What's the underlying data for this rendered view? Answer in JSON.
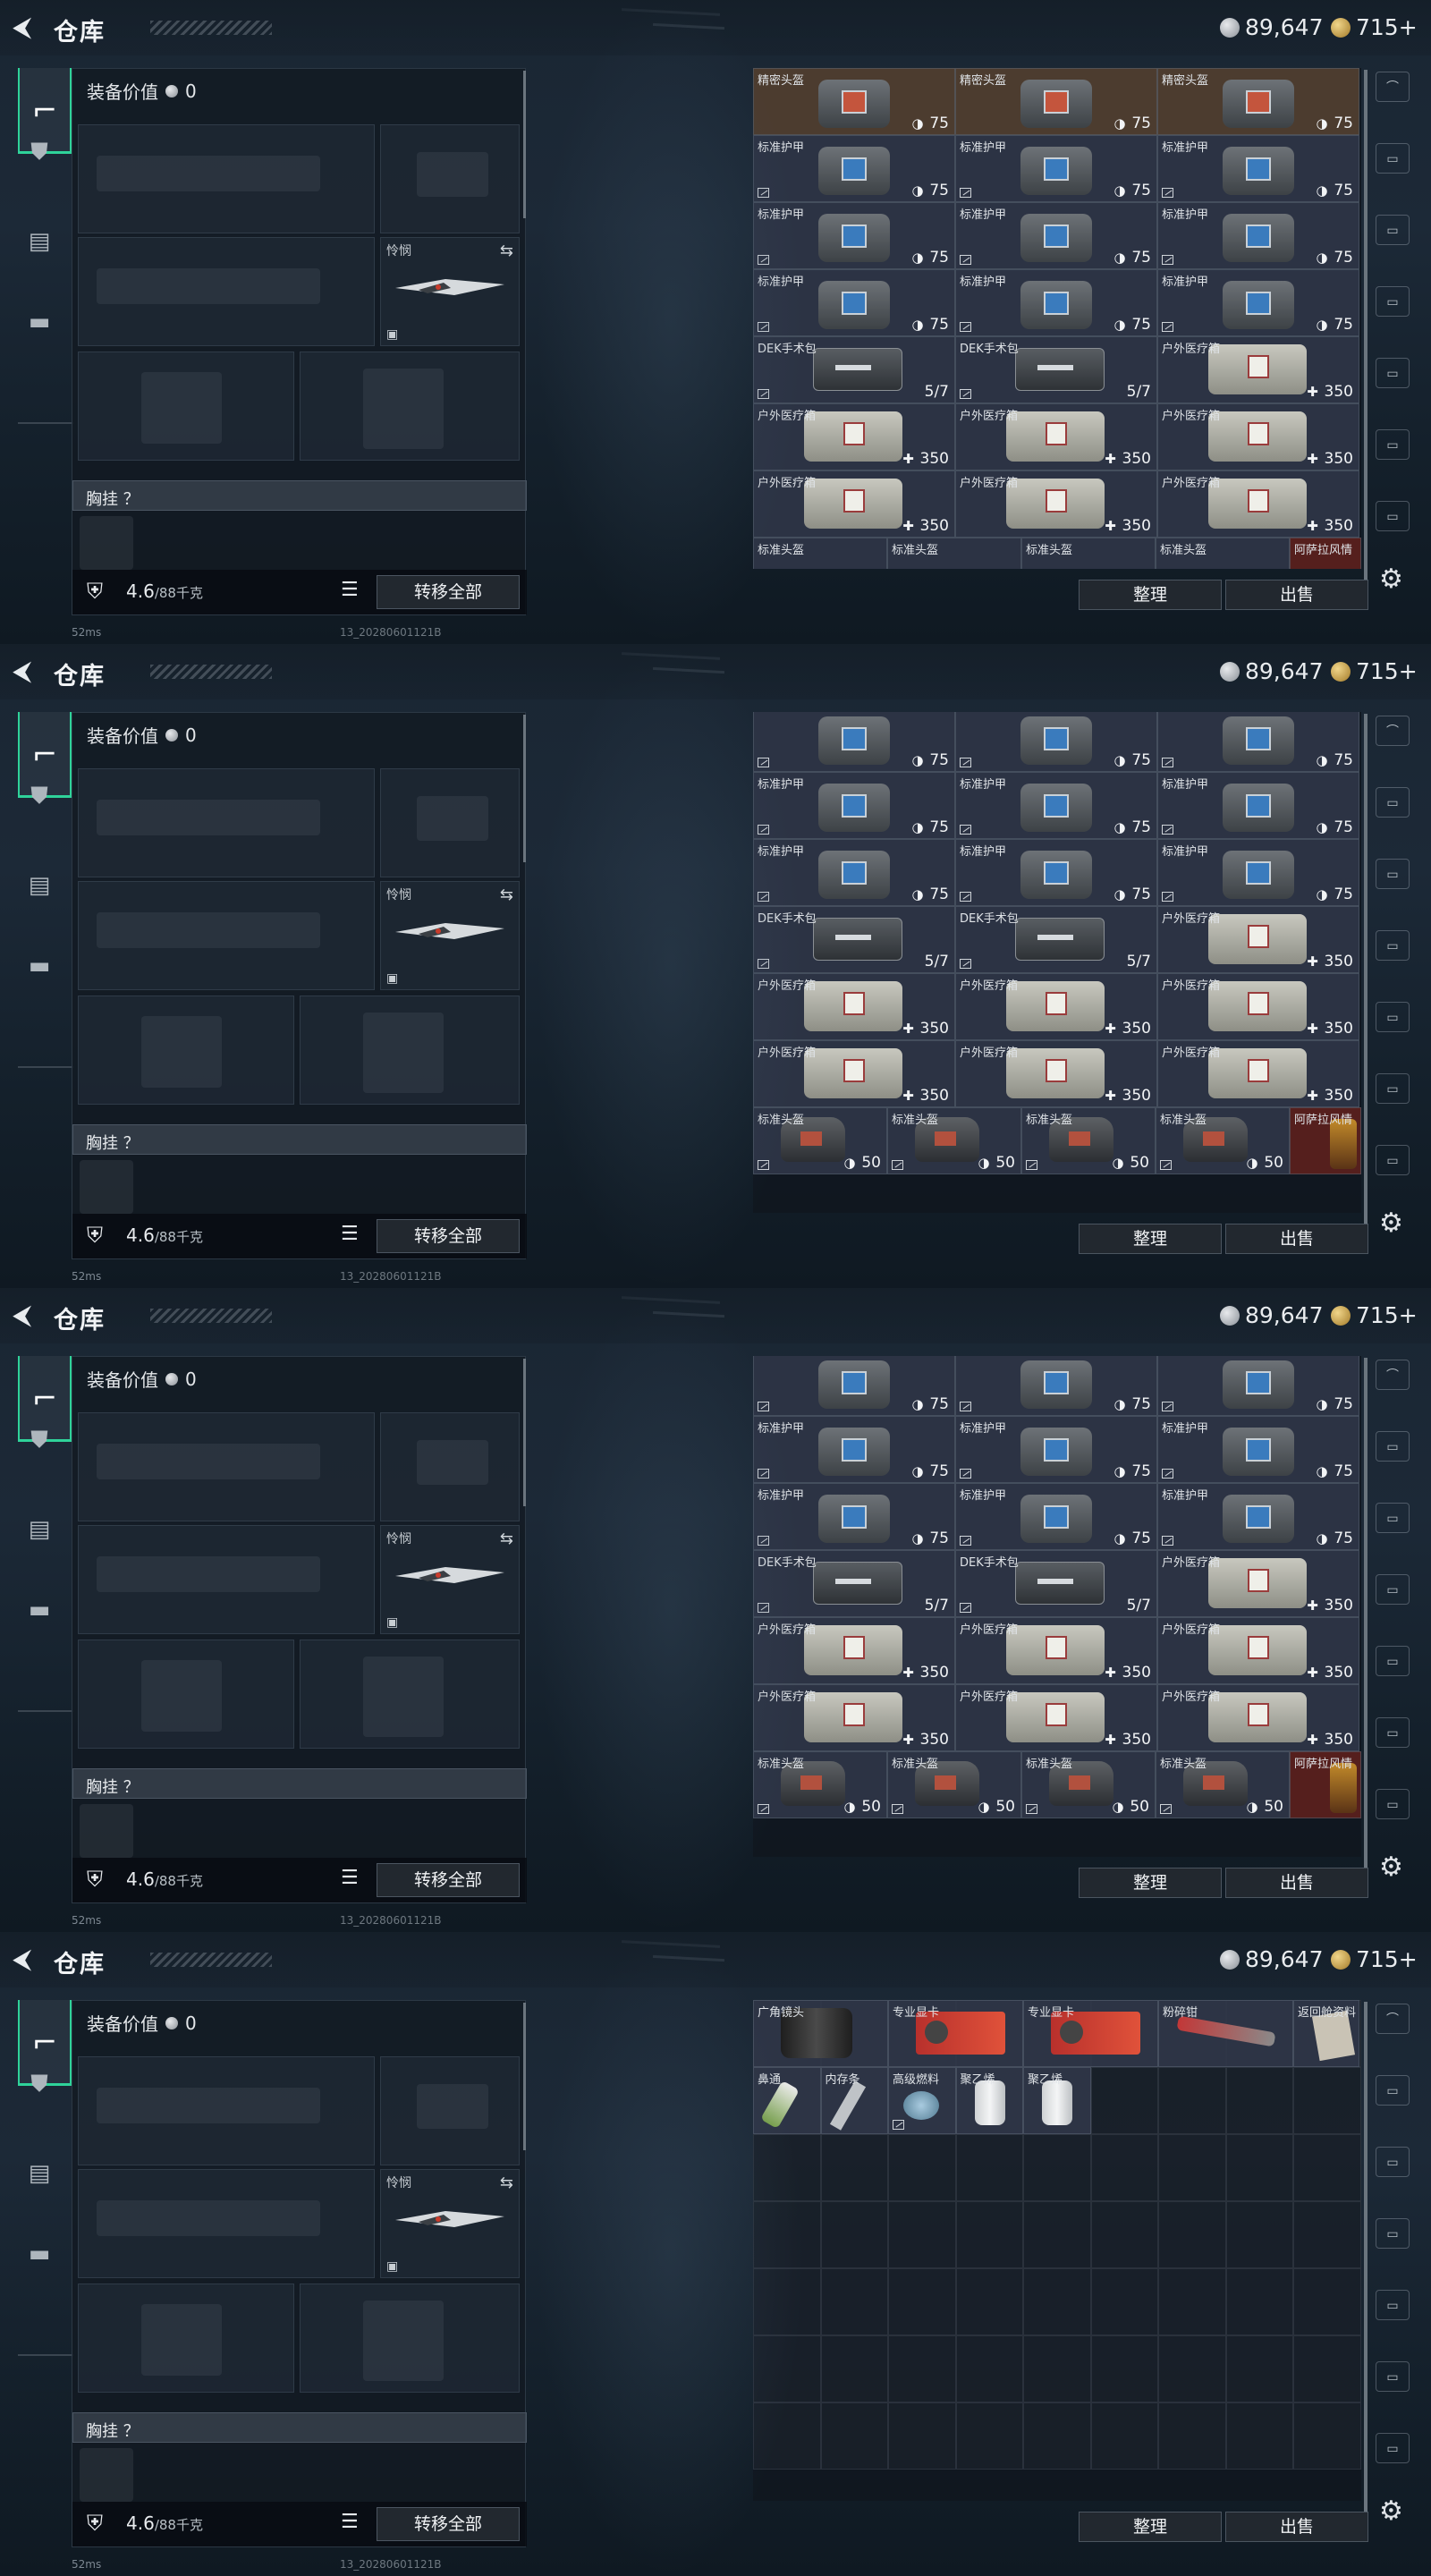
{
  "header": {
    "title": "仓库",
    "silver": "89,647",
    "gold": "715+"
  },
  "loadout": {
    "equip_value_label": "装备价值",
    "equip_value": "0",
    "melee_label": "怜悯",
    "vest_label": "胸挂 ？",
    "weight": "4.6",
    "weight_max": "/88千克",
    "transfer_all": "转移全部"
  },
  "status": {
    "ping": "52ms",
    "build": "13_20280601121B"
  },
  "buttons": {
    "sort": "整理",
    "sell": "出售"
  },
  "icons": {
    "back": "back-arrow-icon",
    "weapon_tab": "gun-icon",
    "badge_tab": "badge-icon",
    "clipboard_tab": "clipboard-icon",
    "case_tab": "briefcase-icon",
    "lock": "padlock-icon",
    "list": "list-icon",
    "swap": "swap-icon",
    "settings": "gear-icon",
    "durability": "shield-icon",
    "heal": "plus-icon",
    "found": "found-in-raid-icon"
  },
  "colors": {
    "accent_green": "#2fd39a",
    "gold_tier": "#50 3e30",
    "purple_tier": "#30364a",
    "red_tier": "#5a201e"
  },
  "screens": [
    {
      "rows": [
        [
          {
            "name": "精密头盔",
            "val": "75",
            "type": "armor-gold",
            "tier": "brown"
          },
          {
            "name": "精密头盔",
            "val": "75",
            "type": "armor-gold",
            "tier": "brown"
          },
          {
            "name": "精密头盔",
            "val": "75",
            "type": "armor-gold",
            "tier": "brown"
          }
        ],
        [
          {
            "name": "标准护甲",
            "val": "75",
            "type": "armor",
            "found": true
          },
          {
            "name": "标准护甲",
            "val": "75",
            "type": "armor",
            "found": true
          },
          {
            "name": "标准护甲",
            "val": "75",
            "type": "armor",
            "found": true
          }
        ],
        [
          {
            "name": "标准护甲",
            "val": "75",
            "type": "armor",
            "found": true
          },
          {
            "name": "标准护甲",
            "val": "75",
            "type": "armor",
            "found": true
          },
          {
            "name": "标准护甲",
            "val": "75",
            "type": "armor",
            "found": true
          }
        ],
        [
          {
            "name": "标准护甲",
            "val": "75",
            "type": "armor",
            "found": true
          },
          {
            "name": "标准护甲",
            "val": "75",
            "type": "armor",
            "found": true
          },
          {
            "name": "标准护甲",
            "val": "75",
            "type": "armor",
            "found": true
          }
        ],
        [
          {
            "name": "DEK手术包",
            "val": "5/7",
            "type": "medkit",
            "found": true
          },
          {
            "name": "DEK手术包",
            "val": "5/7",
            "type": "medkit",
            "found": true
          },
          {
            "name": "户外医疗箱",
            "val": "350",
            "type": "bag"
          }
        ],
        [
          {
            "name": "户外医疗箱",
            "val": "350",
            "type": "bag"
          },
          {
            "name": "户外医疗箱",
            "val": "350",
            "type": "bag"
          },
          {
            "name": "户外医疗箱",
            "val": "350",
            "type": "bag"
          }
        ],
        [
          {
            "name": "户外医疗箱",
            "val": "350",
            "type": "bag"
          },
          {
            "name": "户外医疗箱",
            "val": "350",
            "type": "bag"
          },
          {
            "name": "户外医疗箱",
            "val": "350",
            "type": "bag"
          }
        ]
      ],
      "partial": [
        "标准头盔",
        "标准头盔",
        "标准头盔",
        "标准头盔",
        "阿萨拉风情"
      ]
    },
    {
      "rows": [
        [
          {
            "name": "",
            "val": "75",
            "type": "armor",
            "found": true
          },
          {
            "name": "",
            "val": "75",
            "type": "armor",
            "found": true
          },
          {
            "name": "",
            "val": "75",
            "type": "armor",
            "found": true
          }
        ],
        [
          {
            "name": "标准护甲",
            "val": "75",
            "type": "armor",
            "found": true
          },
          {
            "name": "标准护甲",
            "val": "75",
            "type": "armor",
            "found": true
          },
          {
            "name": "标准护甲",
            "val": "75",
            "type": "armor",
            "found": true
          }
        ],
        [
          {
            "name": "标准护甲",
            "val": "75",
            "type": "armor",
            "found": true
          },
          {
            "name": "标准护甲",
            "val": "75",
            "type": "armor",
            "found": true
          },
          {
            "name": "标准护甲",
            "val": "75",
            "type": "armor",
            "found": true
          }
        ],
        [
          {
            "name": "DEK手术包",
            "val": "5/7",
            "type": "medkit",
            "found": true
          },
          {
            "name": "DEK手术包",
            "val": "5/7",
            "type": "medkit",
            "found": true
          },
          {
            "name": "户外医疗箱",
            "val": "350",
            "type": "bag"
          }
        ],
        [
          {
            "name": "户外医疗箱",
            "val": "350",
            "type": "bag"
          },
          {
            "name": "户外医疗箱",
            "val": "350",
            "type": "bag"
          },
          {
            "name": "户外医疗箱",
            "val": "350",
            "type": "bag"
          }
        ],
        [
          {
            "name": "户外医疗箱",
            "val": "350",
            "type": "bag"
          },
          {
            "name": "户外医疗箱",
            "val": "350",
            "type": "bag"
          },
          {
            "name": "户外医疗箱",
            "val": "350",
            "type": "bag"
          }
        ]
      ],
      "helmets": [
        "标准头盔",
        "标准头盔",
        "标准头盔",
        "标准头盔"
      ],
      "helmet_val": "50",
      "special": "阿萨拉风情"
    },
    {
      "rows": [
        [
          {
            "name": "",
            "val": "75",
            "type": "armor",
            "found": true
          },
          {
            "name": "",
            "val": "75",
            "type": "armor",
            "found": true
          },
          {
            "name": "",
            "val": "75",
            "type": "armor",
            "found": true
          }
        ],
        [
          {
            "name": "标准护甲",
            "val": "75",
            "type": "armor",
            "found": true
          },
          {
            "name": "标准护甲",
            "val": "75",
            "type": "armor",
            "found": true
          },
          {
            "name": "标准护甲",
            "val": "75",
            "type": "armor",
            "found": true
          }
        ],
        [
          {
            "name": "标准护甲",
            "val": "75",
            "type": "armor",
            "found": true
          },
          {
            "name": "标准护甲",
            "val": "75",
            "type": "armor",
            "found": true
          },
          {
            "name": "标准护甲",
            "val": "75",
            "type": "armor",
            "found": true
          }
        ],
        [
          {
            "name": "DEK手术包",
            "val": "5/7",
            "type": "medkit",
            "found": true
          },
          {
            "name": "DEK手术包",
            "val": "5/7",
            "type": "medkit",
            "found": true
          },
          {
            "name": "户外医疗箱",
            "val": "350",
            "type": "bag"
          }
        ],
        [
          {
            "name": "户外医疗箱",
            "val": "350",
            "type": "bag"
          },
          {
            "name": "户外医疗箱",
            "val": "350",
            "type": "bag"
          },
          {
            "name": "户外医疗箱",
            "val": "350",
            "type": "bag"
          }
        ],
        [
          {
            "name": "户外医疗箱",
            "val": "350",
            "type": "bag"
          },
          {
            "name": "户外医疗箱",
            "val": "350",
            "type": "bag"
          },
          {
            "name": "户外医疗箱",
            "val": "350",
            "type": "bag"
          }
        ]
      ],
      "helmets": [
        "标准头盔",
        "标准头盔",
        "标准头盔",
        "标准头盔"
      ],
      "helmet_val": "50",
      "special": "阿萨拉风情"
    },
    {
      "misc_rows": [
        [
          {
            "name": "广角镜头",
            "type": "lens",
            "w": 2
          },
          {
            "name": "专业显卡",
            "type": "gpu",
            "w": 2
          },
          {
            "name": "专业显卡",
            "type": "gpu",
            "w": 2
          },
          {
            "name": "粉碎钳",
            "type": "cutter",
            "w": 2
          },
          {
            "name": "返回舱资料",
            "type": "paper",
            "w": 1
          }
        ],
        [
          {
            "name": "鼻通",
            "type": "tube",
            "w": 1
          },
          {
            "name": "内存条",
            "type": "stick",
            "w": 1
          },
          {
            "name": "高级燃料",
            "type": "fuel",
            "w": 1,
            "found": true
          },
          {
            "name": "聚乙烯",
            "type": "roll",
            "w": 1
          },
          {
            "name": "聚乙烯",
            "type": "roll",
            "w": 1
          }
        ]
      ]
    }
  ]
}
